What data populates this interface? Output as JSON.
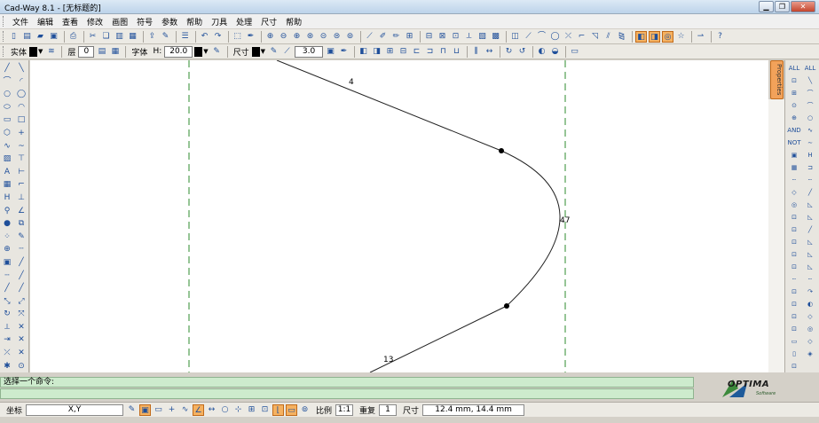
{
  "window": {
    "title": "Cad-Way 8.1 - [无标题的]"
  },
  "menu": [
    "文件",
    "编辑",
    "查看",
    "修改",
    "画图",
    "符号",
    "参数",
    "帮助",
    "刀具",
    "处理",
    "尺寸",
    "帮助"
  ],
  "toolbar2": {
    "solid_label": "实体",
    "layer_label": "层",
    "layer_value": "0",
    "font_label": "字体",
    "font_size_label": "H:",
    "font_size_value": "20.0",
    "dim_label": "尺寸",
    "dim_value": "3.0"
  },
  "palette_tab": "Properties",
  "drawing": {
    "dim_top": "4",
    "dim_right": "47",
    "dim_bottom": "13"
  },
  "command": {
    "prompt": "选择一个命令:",
    "input": ""
  },
  "logo": {
    "text": "OPTIMA",
    "sub": "Software"
  },
  "status": {
    "coord_label": "坐标",
    "coord_mode": "X,Y",
    "scale_label": "比例",
    "scale_value": "1:1",
    "repeat_label": "重复",
    "repeat_value": "1",
    "size_label": "尺寸",
    "cursor_readout": "12.4 mm,    14.4 mm"
  },
  "colors": {
    "construction_line": "#2e8b2e",
    "command_bg": "#cdebcd",
    "active_tool": "#f5b160"
  },
  "icons": {
    "toolbar1": [
      "new-icon",
      "open-icon",
      "folder-icon",
      "save-icon",
      "print-icon",
      "cut-icon",
      "copy-icon",
      "paste-icon",
      "clipboard-icon",
      "export-icon",
      "brush-icon",
      "list-icon",
      "undo-icon",
      "redo-icon",
      "select-icon",
      "pen-icon",
      "zoom-window-icon",
      "zoom-out-icon",
      "zoom-in-icon",
      "zoom-all-icon",
      "zoom-prev-icon",
      "zoom-extents-icon",
      "pan-icon",
      "snap-icon",
      "edit-icon",
      "pencil-icon",
      "grid-icon",
      "ortho-icon",
      "node-icon",
      "trim-icon",
      "measure-icon",
      "hatch-icon",
      "block-icon",
      "explode-icon",
      "line-icon",
      "arc-icon",
      "circle-icon",
      "star-icon",
      "help-icon"
    ],
    "left": [
      "line-icon",
      "arc-icon",
      "circle-icon",
      "ellipse-icon",
      "rect-icon",
      "polygon-icon",
      "spline-icon",
      "text-icon",
      "hatch-icon",
      "dim-icon",
      "move-icon",
      "rotate-icon",
      "mirror-icon",
      "trim-icon",
      "extend-icon",
      "fillet-icon",
      "chamfer-icon",
      "offset-icon",
      "erase-icon",
      "break-icon",
      "join-icon",
      "scale-icon"
    ],
    "right": [
      "layer-icon",
      "snap-end-icon",
      "snap-mid-icon",
      "snap-center-icon",
      "snap-node-icon",
      "snap-quad-icon",
      "snap-int-icon",
      "snap-perp-icon",
      "snap-tan-icon",
      "snap-near-icon",
      "snap-par-icon",
      "snap-ext-icon"
    ]
  }
}
